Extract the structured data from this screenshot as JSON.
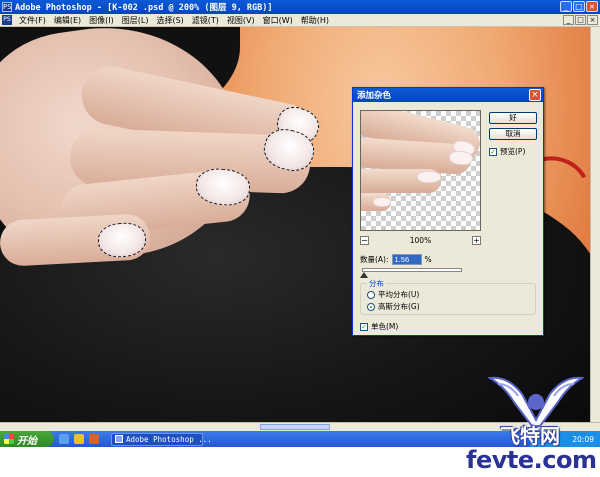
{
  "titlebar": {
    "title": "Adobe Photoshop - [K-002 .psd @ 200% (图层 9, RGB)]",
    "app_icon": "PS",
    "minimize": "_",
    "maximize": "□",
    "close": "×"
  },
  "menubar": {
    "items": [
      "文件(F)",
      "编辑(E)",
      "图像(I)",
      "图层(L)",
      "选择(S)",
      "滤镜(T)",
      "视图(V)",
      "窗口(W)",
      "帮助(H)"
    ]
  },
  "dialog": {
    "title": "添加杂色",
    "close": "×",
    "ok_label": "好",
    "cancel_label": "取消",
    "preview_label": "预览(P)",
    "preview_checked": "✓",
    "zoom_out": "−",
    "zoom_in": "+",
    "zoom_value": "100%",
    "amount_label": "数量(A):",
    "amount_value": "1.56",
    "amount_unit": "%",
    "amount_slider_fraction": 0.02,
    "distribution_label": "分布",
    "uniform_label": "平均分布(U)",
    "gaussian_label": "高斯分布(G)",
    "monochrome_label": "单色(M)",
    "monochrome_checked": "✓"
  },
  "taskbar": {
    "start_label": "开始",
    "task_label": "Adobe Photoshop ...",
    "clock": "20:09"
  },
  "watermark": {
    "cn_text": "飞特网",
    "url_text": "fevte.com"
  },
  "colors": {
    "xp_blue": "#0846b8",
    "start_green": "#2f8a26",
    "skin_orange": "#f0a870",
    "watermark_blue": "#2b3296"
  }
}
